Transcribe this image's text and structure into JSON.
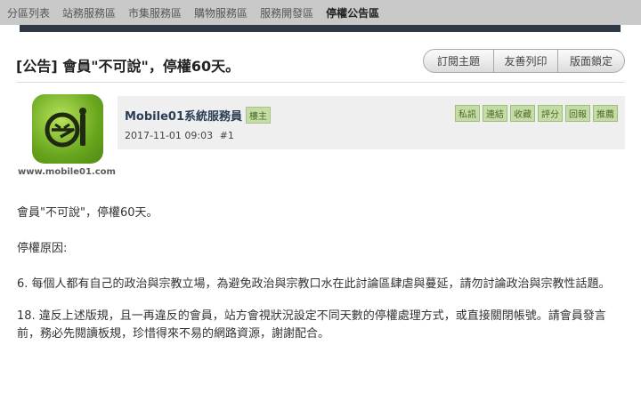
{
  "nav": {
    "items": [
      "分區列表",
      "站務服務區",
      "市集服務區",
      "購物服務區",
      "服務開發區",
      "停權公告區"
    ],
    "active_index": 5
  },
  "thread": {
    "title": "[公告] 會員\"不可說\"，停權60天。",
    "buttons": {
      "subscribe": "訂閱主題",
      "print": "友善列印",
      "lock": "版面鎖定"
    }
  },
  "post": {
    "avatar_site_text": "www.mobile01.com",
    "author": "Mobile01系統服務員",
    "op_badge": "樓主",
    "datetime": "2017-11-01 09:03",
    "floor": "#1",
    "actions": [
      "私訊",
      "連結",
      "收藏",
      "評分",
      "回報",
      "推薦"
    ],
    "paragraphs": [
      "會員\"不可說\"，停權60天。",
      "停權原因:",
      "6. 每個人都有自己的政治與宗教立場，為避免政治與宗教口水在此討論區肆虐與蔓延，請勿討論政治與宗教性話題。",
      "18. 違反上述版規，且一再違反的會員，站方會視狀況設定不同天數的停權處理方式，或直接關閉帳號。請會員發言前，務必先閱讀板規，珍惜得來不易的網路資源，謝謝配合。"
    ]
  },
  "colors": {
    "nav_bg": "#c9c9c9",
    "badge_bg": "#c6dca8",
    "header_bg": "#efefef",
    "logo_green": "#69a61e"
  },
  "icons": {
    "avatar": "mobile01-logo-icon"
  }
}
